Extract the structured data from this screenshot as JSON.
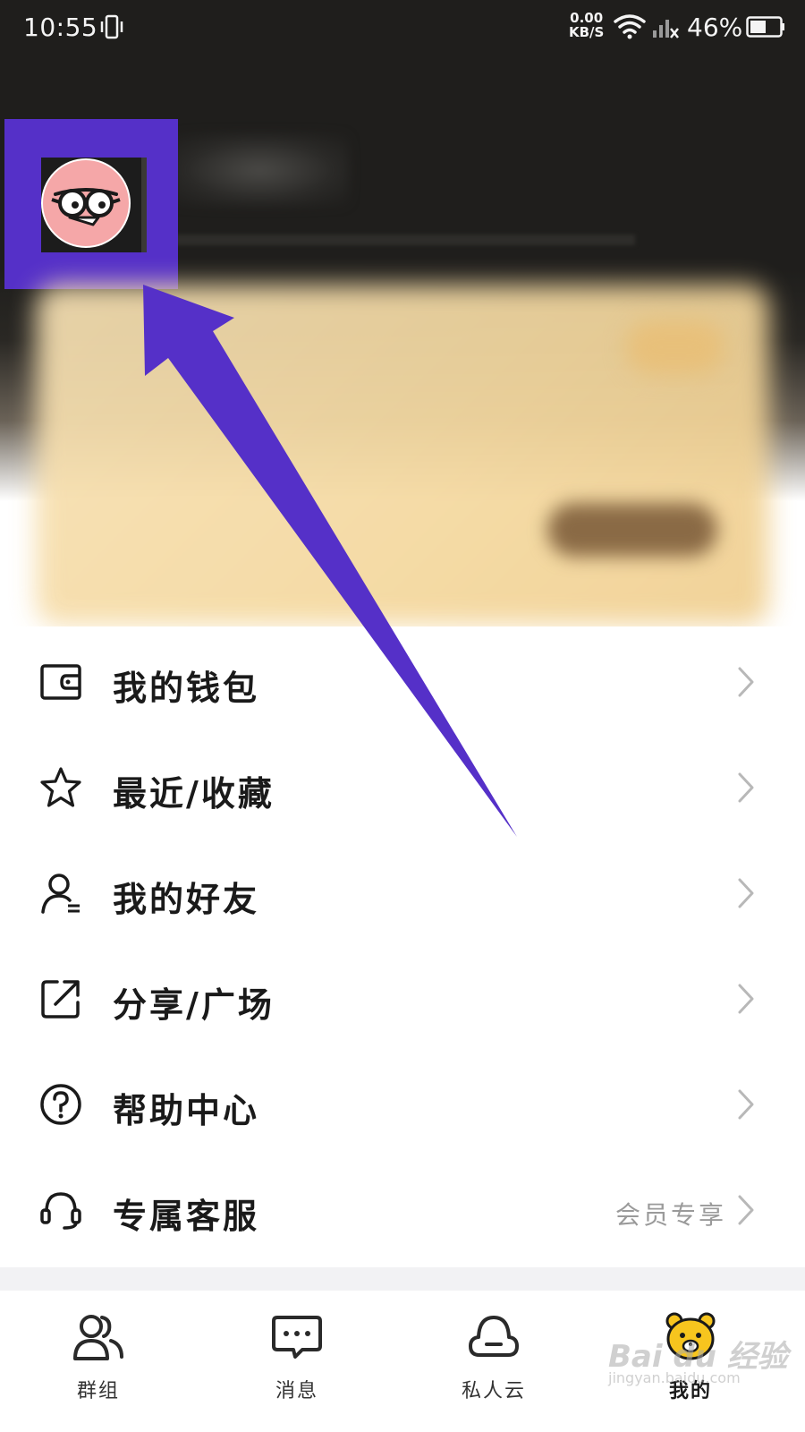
{
  "status_bar": {
    "time": "10:55",
    "net_speed_value": "0.00",
    "net_speed_unit": "KB/S",
    "battery_percent": "46%"
  },
  "menu": {
    "items": [
      {
        "label": "我的钱包",
        "icon": "wallet-icon"
      },
      {
        "label": "最近/收藏",
        "icon": "star-icon"
      },
      {
        "label": "我的好友",
        "icon": "friend-icon"
      },
      {
        "label": "分享/广场",
        "icon": "share-icon"
      },
      {
        "label": "帮助中心",
        "icon": "help-icon"
      },
      {
        "label": "专属客服",
        "icon": "headset-icon",
        "extra": "会员专享"
      }
    ]
  },
  "bottom_nav": {
    "items": [
      {
        "label": "群组",
        "icon": "group-icon"
      },
      {
        "label": "消息",
        "icon": "message-icon"
      },
      {
        "label": "私人云",
        "icon": "cloud-icon"
      },
      {
        "label": "我的",
        "icon": "bear-icon",
        "active": true
      }
    ]
  },
  "watermark": {
    "brand": "Bai du 经验",
    "url": "jingyan.baidu.com"
  },
  "colors": {
    "header_bg": "#1f1e1c",
    "highlight": "#5530c8",
    "avatar_bg": "#f5a7a8",
    "card_gold": "#f5d9a0"
  }
}
